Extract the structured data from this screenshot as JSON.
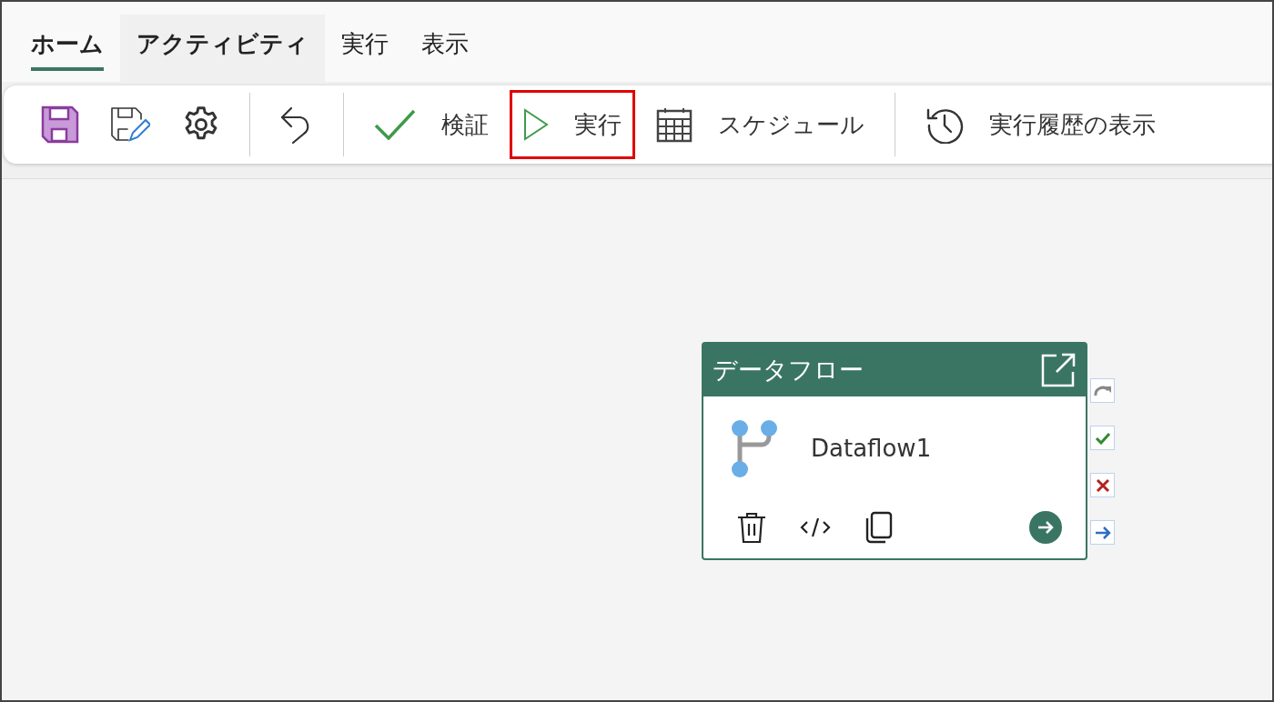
{
  "tabs": [
    {
      "label": "ホーム",
      "selected": true,
      "hovered": false
    },
    {
      "label": "アクティビティ",
      "selected": false,
      "hovered": true
    },
    {
      "label": "実行",
      "selected": false,
      "hovered": false
    },
    {
      "label": "表示",
      "selected": false,
      "hovered": false
    }
  ],
  "toolbar": [
    {
      "kind": "save"
    },
    {
      "kind": "save-as"
    },
    {
      "kind": "settings"
    },
    {
      "kind": "separator"
    },
    {
      "kind": "undo"
    },
    {
      "kind": "separator"
    },
    {
      "kind": "validate",
      "label": "検証",
      "highlighted": false
    },
    {
      "kind": "run",
      "label": "実行",
      "highlighted": true
    },
    {
      "kind": "schedule",
      "label": "スケジュール",
      "highlighted": false
    },
    {
      "kind": "separator"
    },
    {
      "kind": "history",
      "label": "実行履歴の表示",
      "highlighted": false
    }
  ],
  "activity": {
    "type": "データフロー",
    "name": "Dataflow1"
  },
  "ports": [
    {
      "kind": "skip"
    },
    {
      "kind": "success"
    },
    {
      "kind": "fail"
    },
    {
      "kind": "complete"
    }
  ]
}
